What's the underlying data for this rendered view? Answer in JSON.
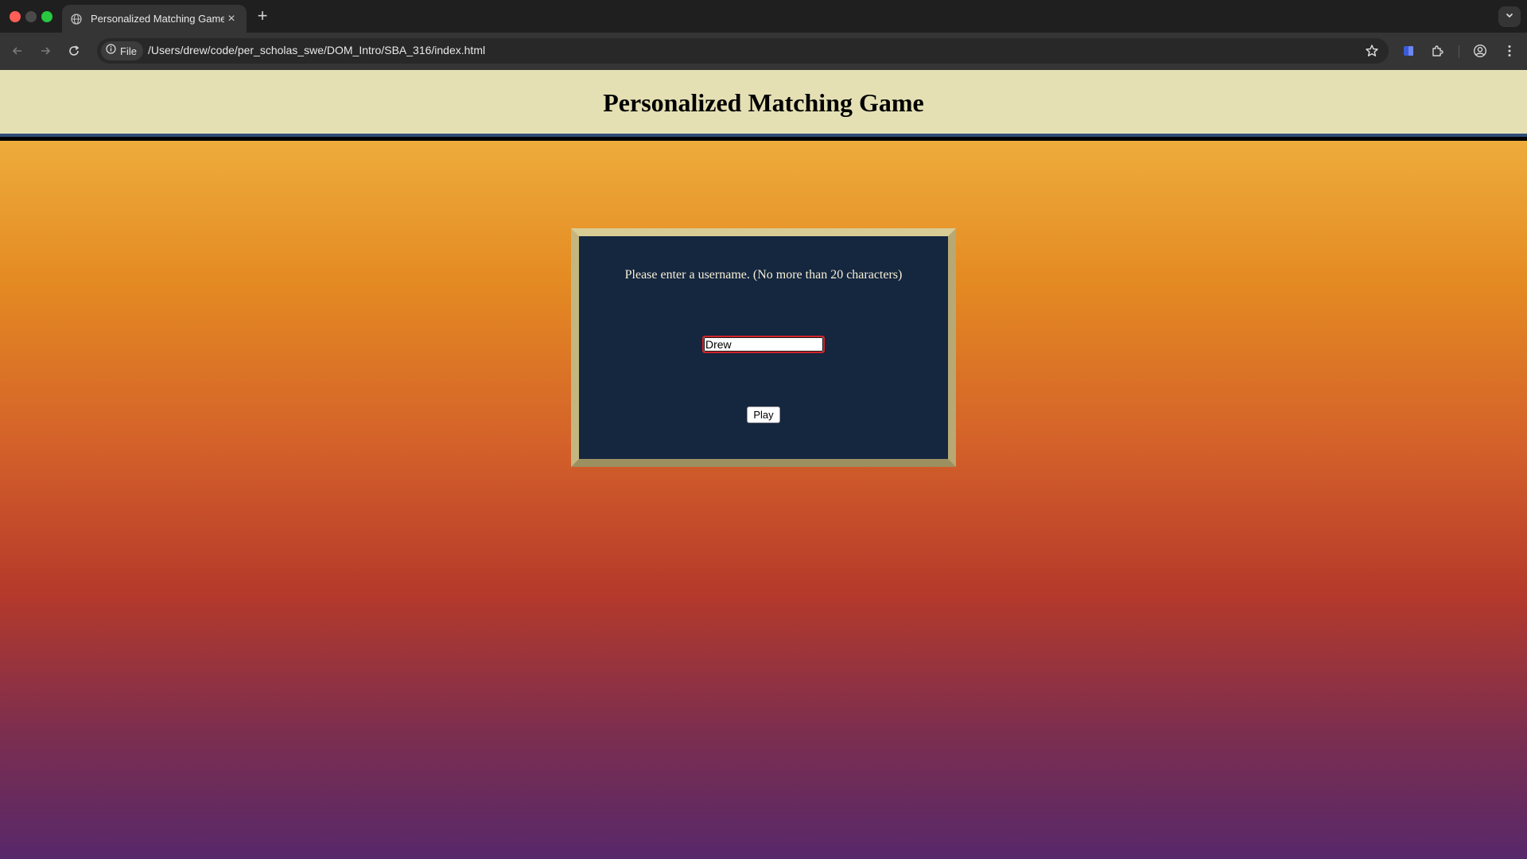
{
  "browser": {
    "tab": {
      "title": "Personalized Matching Game",
      "favicon_icon": "globe-icon",
      "close_label": "×"
    },
    "new_tab_label": "+",
    "omnibox": {
      "chip_label": "File",
      "url": "/Users/drew/code/per_scholas_swe/DOM_Intro/SBA_316/index.html"
    }
  },
  "page": {
    "title": "Personalized Matching Game",
    "prompt": "Please enter a username. (No more than 20 characters)",
    "username_value": "Drew",
    "play_label": "Play"
  },
  "colors": {
    "header_bg": "#e5e0b4",
    "box_bg": "#15263f",
    "box_frame": "#c4b67e",
    "input_focus_border": "#d2232a",
    "gradient_top": "#f2bd47",
    "gradient_bottom": "#57286a"
  }
}
